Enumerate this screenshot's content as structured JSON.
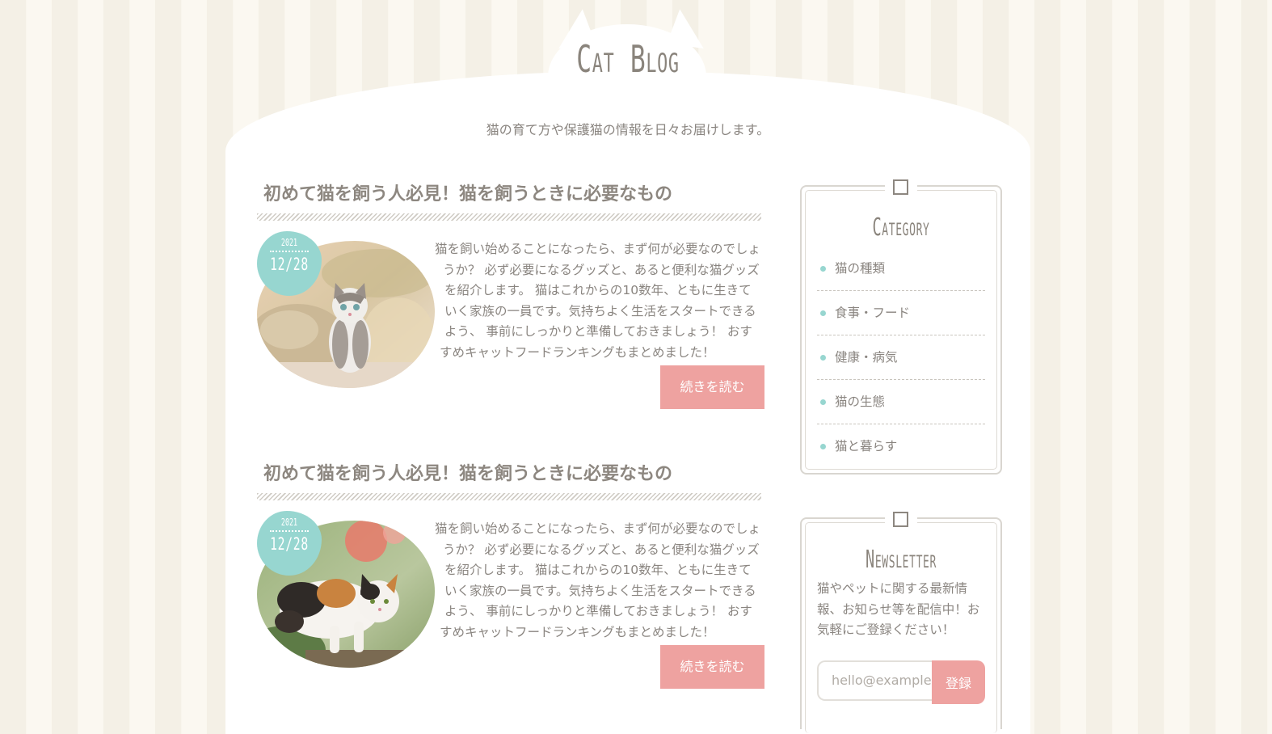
{
  "site": {
    "title": "Cat Blog",
    "tagline": "猫の育て方や保護猫の情報を日々お届けします。"
  },
  "posts": [
    {
      "title": "初めて猫を飼う人必見！猫を飼うときに必要なもの",
      "date_year": "2021",
      "date_day": "12/28",
      "image_icon": "kitten-photo",
      "excerpt": "猫を飼い始めることになったら、まず何が必要なのでしょうか？ 必ず必要になるグッズと、あると便利な猫グッズを紹介します。 猫はこれからの10数年、ともに生きていく家族の一員です。気持ちよく生活をスタートできるよう、 事前にしっかりと準備しておきましょう！ おすすめキャットフードランキングもまとめました！",
      "read_more": "続きを読む"
    },
    {
      "title": "初めて猫を飼う人必見！猫を飼うときに必要なもの",
      "date_year": "2021",
      "date_day": "12/28",
      "image_icon": "calico-cat-photo",
      "excerpt": "猫を飼い始めることになったら、まず何が必要なのでしょうか？ 必ず必要になるグッズと、あると便利な猫グッズを紹介します。 猫はこれからの10数年、ともに生きていく家族の一員です。気持ちよく生活をスタートできるよう、 事前にしっかりと準備しておきましょう！ おすすめキャットフードランキングもまとめました！",
      "read_more": "続きを読む"
    }
  ],
  "sidebar": {
    "category": {
      "title": "Category",
      "items": [
        "猫の種類",
        "食事・フード",
        "健康・病気",
        "猫の生態",
        "猫と暮らす"
      ]
    },
    "newsletter": {
      "title": "Newsletter",
      "text": "猫やペットに関する最新情報、お知らせ等を配信中！お気軽にご登録ください！",
      "input_placeholder": "hello@example.com",
      "button_label": "登録"
    }
  },
  "colors": {
    "accent_pink": "#eea2a0",
    "accent_mint": "#97d6d0",
    "text": "#8a8580"
  }
}
